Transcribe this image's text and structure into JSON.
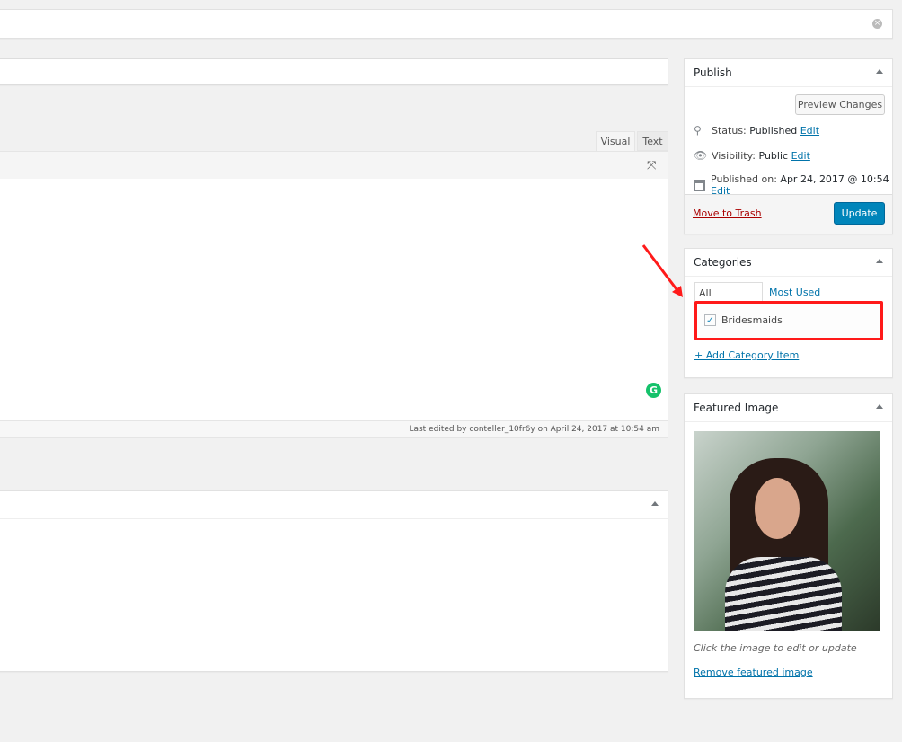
{
  "editor": {
    "tabs": [
      {
        "label": "Visual",
        "active": true
      },
      {
        "label": "Text",
        "active": false
      }
    ],
    "status_bar": "Last edited by conteller_10fr6y on April 24, 2017 at 10:54 am"
  },
  "publish": {
    "title": "Publish",
    "preview_label": "Preview Changes",
    "status_label": "Status:",
    "status_value": "Published",
    "visibility_label": "Visibility:",
    "visibility_value": "Public",
    "published_label": "Published on:",
    "published_value": "Apr 24, 2017 @ 10:54",
    "edit_label": "Edit",
    "trash_label": "Move to Trash",
    "update_label": "Update"
  },
  "categories": {
    "title": "Categories",
    "tabs": [
      "All Categories",
      "Most Used"
    ],
    "items": [
      {
        "label": "Bridesmaids",
        "checked": true
      }
    ],
    "add_label": "+ Add Category Item"
  },
  "featured": {
    "title": "Featured Image",
    "caption": "Click the image to edit or update",
    "remove_label": "Remove featured image"
  },
  "colors": {
    "accent": "#0085ba",
    "link": "#0073aa",
    "annotation": "#ff1a1a",
    "trash": "#a00"
  }
}
